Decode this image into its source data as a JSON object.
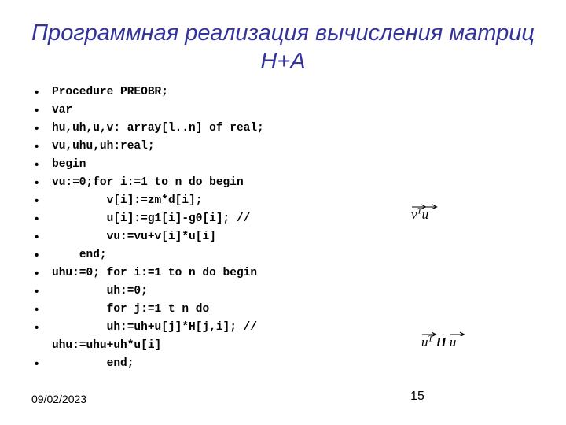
{
  "slide": {
    "title": "Программная реализация вычисления матриц H+A",
    "title_line_1": "Программная реализация вычисления",
    "title_line_2": "матриц H+A",
    "title_color": "#333399",
    "background_color": "#ffffff",
    "text_color": "#000000"
  },
  "code": {
    "lines": [
      {
        "text": "Procedure PREOBR;",
        "bullet": true
      },
      {
        "text": "var",
        "bullet": true
      },
      {
        "text": "hu,uh,u,v: array[l..n] of real;",
        "bullet": true
      },
      {
        "text": "vu,uhu,uh:real;",
        "bullet": true
      },
      {
        "text": "begin",
        "bullet": true
      },
      {
        "text": "vu:=0;for i:=1 to n do begin",
        "bullet": true
      },
      {
        "text": "        v[i]:=zm*d[i];",
        "bullet": true
      },
      {
        "text": "        u[i]:=g1[i]-g0[i]; //",
        "bullet": true
      },
      {
        "text": "        vu:=vu+v[i]*u[i]",
        "bullet": true
      },
      {
        "text": "    end;",
        "bullet": true
      },
      {
        "text": "uhu:=0; for i:=1 to n do begin",
        "bullet": true
      },
      {
        "text": "        uh:=0;",
        "bullet": true
      },
      {
        "text": "        for j:=1 t n do",
        "bullet": true
      },
      {
        "text": "        uh:=uh+u[j]*H[j,i]; // uhu:=uhu+uh*u[i]",
        "bullet": true
      },
      {
        "text": "        end;",
        "bullet": true
      }
    ]
  },
  "formulas": [
    {
      "id": "vt-u",
      "latex": "\\vec{v}^{T}\\vec{u}",
      "plain": "v^T u",
      "left_operand": "v",
      "superscript": "T",
      "right_operand": "u"
    },
    {
      "id": "ut-h-u",
      "latex": "\\vec{u}^{T} H \\vec{u}",
      "plain": "u^T H u",
      "left_operand": "u",
      "superscript": "T",
      "operator": "H",
      "right_operand": "u"
    }
  ],
  "footer": {
    "date": "09/02/2023",
    "page_number": "15"
  }
}
